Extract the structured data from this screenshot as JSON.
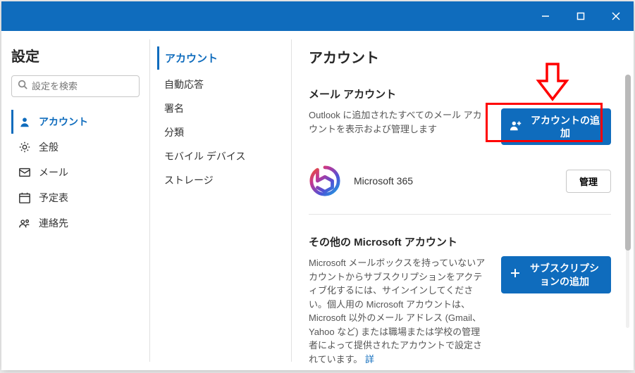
{
  "titlebar": {
    "min": "minimize",
    "max": "maximize",
    "close": "close"
  },
  "left": {
    "title": "設定",
    "search_placeholder": "設定を検索",
    "nav": [
      {
        "label": "アカウント",
        "active": true
      },
      {
        "label": "全般"
      },
      {
        "label": "メール"
      },
      {
        "label": "予定表"
      },
      {
        "label": "連絡先"
      }
    ]
  },
  "mid": {
    "heading": "アカウント",
    "items": [
      "自動応答",
      "署名",
      "分類",
      "モバイル デバイス",
      "ストレージ"
    ]
  },
  "main": {
    "title": "アカウント",
    "mail_section": {
      "heading": "メール アカウント",
      "desc": "Outlook に追加されたすべてのメール アカウントを表示および管理します",
      "add_btn": "アカウントの追加"
    },
    "account_row": {
      "name": "Microsoft 365",
      "manage_btn": "管理"
    },
    "other_section": {
      "heading": "その他の Microsoft アカウント",
      "desc": "Microsoft メールボックスを持っていないアカウントからサブスクリプションをアクティブ化するには、サインインしてください。個人用の Microsoft アカウントは、Microsoft 以外のメール アドレス (Gmail、Yahoo など) または職場または学校の管理者によって提供されたアカウントで設定されています。",
      "more": "詳",
      "sub_btn": "サブスクリプションの追加"
    }
  }
}
